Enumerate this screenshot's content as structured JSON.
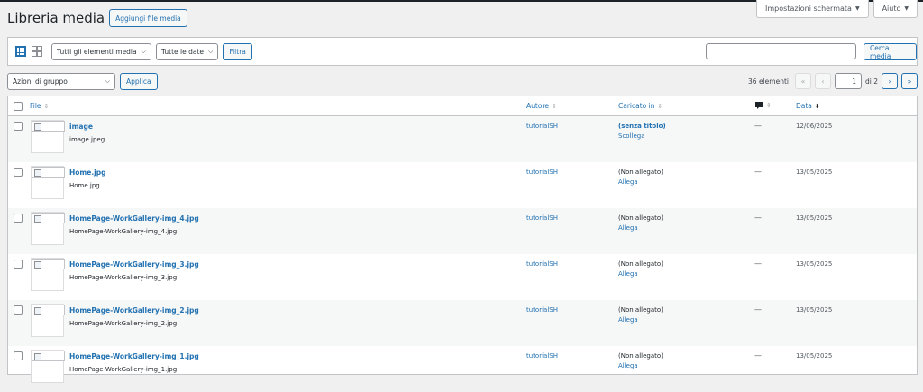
{
  "screen_options": {
    "label": "Impostazioni schermata"
  },
  "help": {
    "label": "Aiuto"
  },
  "page": {
    "title": "Libreria media",
    "add_button": "Aggiungi file media"
  },
  "filters": {
    "media_type": "Tutti gli elementi media",
    "dates": "Tutte le date",
    "filter_button": "Filtra",
    "search_placeholder": "",
    "search_button": "Cerca media"
  },
  "bulk": {
    "action": "Azioni di gruppo",
    "apply": "Applica"
  },
  "pagination": {
    "count": "36 elementi",
    "first": "«",
    "prev": "‹",
    "current_page": "1",
    "of": "di 2",
    "next": "›",
    "last": "»"
  },
  "table": {
    "columns": {
      "file": "File",
      "author": "Autore",
      "uploaded_to": "Caricato in",
      "comments": "",
      "date": "Data"
    },
    "rows": [
      {
        "title": "image",
        "filename": "image.jpeg",
        "author": "tutorialSH",
        "uploaded_to": "(senza titolo)",
        "action": "Scollega",
        "comments": "—",
        "date": "12/06/2025"
      },
      {
        "title": "Home.jpg",
        "filename": "Home.jpg",
        "author": "tutorialSH",
        "uploaded_to": "(Non allegato)",
        "action": "Allega",
        "comments": "—",
        "date": "13/05/2025"
      },
      {
        "title": "HomePage-WorkGallery-img_4.jpg",
        "filename": "HomePage-WorkGallery-img_4.jpg",
        "author": "tutorialSH",
        "uploaded_to": "(Non allegato)",
        "action": "Allega",
        "comments": "—",
        "date": "13/05/2025"
      },
      {
        "title": "HomePage-WorkGallery-img_3.jpg",
        "filename": "HomePage-WorkGallery-img_3.jpg",
        "author": "tutorialSH",
        "uploaded_to": "(Non allegato)",
        "action": "Allega",
        "comments": "—",
        "date": "13/05/2025"
      },
      {
        "title": "HomePage-WorkGallery-img_2.jpg",
        "filename": "HomePage-WorkGallery-img_2.jpg",
        "author": "tutorialSH",
        "uploaded_to": "(Non allegato)",
        "action": "Allega",
        "comments": "—",
        "date": "13/05/2025"
      },
      {
        "title": "HomePage-WorkGallery-img_1.jpg",
        "filename": "HomePage-WorkGallery-img_1.jpg",
        "author": "tutorialSH",
        "uploaded_to": "(Non allegato)",
        "action": "Allega",
        "comments": "—",
        "date": "13/05/2025"
      }
    ]
  },
  "colors": {
    "accent": "#2271b1",
    "background": "#f0f0f1",
    "row_alt": "#f6f7f7"
  },
  "icons": {
    "list_view": "list-view-icon",
    "grid_view": "grid-view-icon",
    "comment": "comment-bubble-icon"
  }
}
